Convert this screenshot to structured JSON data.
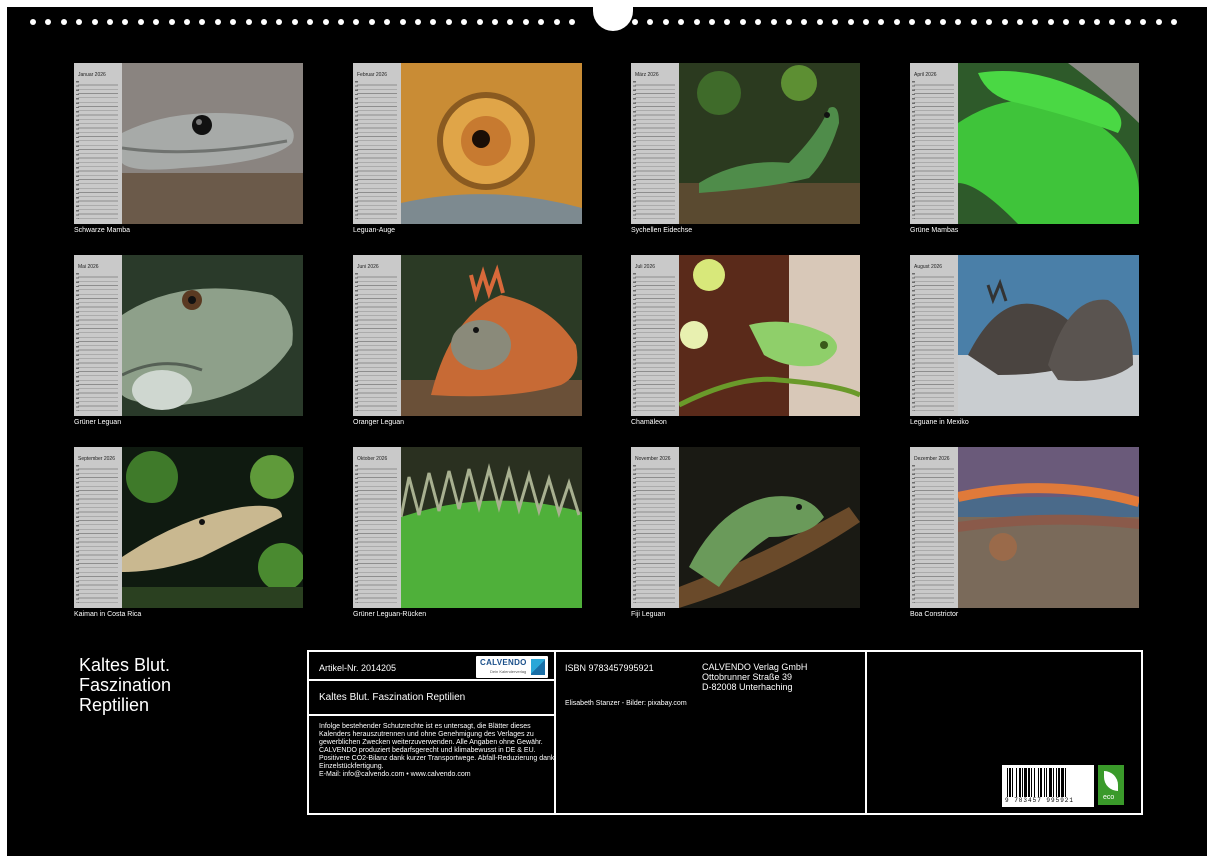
{
  "calendar_title_lines": [
    "Kaltes Blut.",
    "Faszination",
    "Reptilien"
  ],
  "months": [
    {
      "month": "Januar",
      "year": "2026",
      "caption": "Schwarze Mamba",
      "photo": "black-mamba-head"
    },
    {
      "month": "Februar",
      "year": "2026",
      "caption": "Leguan-Auge",
      "photo": "iguana-eye"
    },
    {
      "month": "März",
      "year": "2026",
      "caption": "Sychellen Eidechse",
      "photo": "green-lizard"
    },
    {
      "month": "April",
      "year": "2026",
      "caption": "Grüne Mambas",
      "photo": "green-mambas"
    },
    {
      "month": "Mai",
      "year": "2026",
      "caption": "Grüner Leguan",
      "photo": "green-iguana-head"
    },
    {
      "month": "Juni",
      "year": "2026",
      "caption": "Oranger Leguan",
      "photo": "orange-iguana"
    },
    {
      "month": "Juli",
      "year": "2026",
      "caption": "Chamäleon",
      "photo": "chameleon"
    },
    {
      "month": "August",
      "year": "2026",
      "caption": "Leguane in Mexiko",
      "photo": "iguanas-on-rock"
    },
    {
      "month": "September",
      "year": "2026",
      "caption": "Kaiman in Costa Rica",
      "photo": "caiman"
    },
    {
      "month": "Oktober",
      "year": "2026",
      "caption": "Grüner Leguan-Rücken",
      "photo": "iguana-back"
    },
    {
      "month": "November",
      "year": "2026",
      "caption": "Fiji Leguan",
      "photo": "fiji-iguana"
    },
    {
      "month": "Dezember",
      "year": "2026",
      "caption": "Boa Constrictor",
      "photo": "boa-constrictor"
    }
  ],
  "info": {
    "article_no": "Artikel-Nr. 2014205",
    "product_title": "Kaltes Blut. Faszination Reptilien",
    "legal_text": "Infolge bestehender Schutzrechte ist es untersagt, die Blätter dieses Kalenders herauszutrennen und ohne Genehmigung des Verlages zu gewerblichen Zwecken weiterzuverwenden. Alle Angaben ohne Gewähr. CALVENDO produziert bedarfsgerecht und klimabewusst in DE & EU. Positivere CO2-Bilanz dank kurzer Transportwege. Abfall-Reduzierung dank Einzelstückfertigung.",
    "contact": "E-Mail: info@calvendo.com • www.calvendo.com",
    "isbn": "ISBN 9783457995921",
    "publisher_lines": [
      "CALVENDO Verlag GmbH",
      "Ottobrunner Straße 39",
      "D-82008 Unterhaching"
    ],
    "credits": "Elisabeth Stanzer - Bilder: pixabay.com",
    "barcode_number": "9 783457 995921",
    "logo_brand": "CALVENDO",
    "logo_sub": "Dein Kalenderverlag",
    "eco_label": "eco"
  },
  "colors": {
    "page_background": "#000000",
    "calendar_strip": "#c9c9c9",
    "eco_green": "#3a9a2a",
    "logo_blue": "#1a4f8a"
  }
}
